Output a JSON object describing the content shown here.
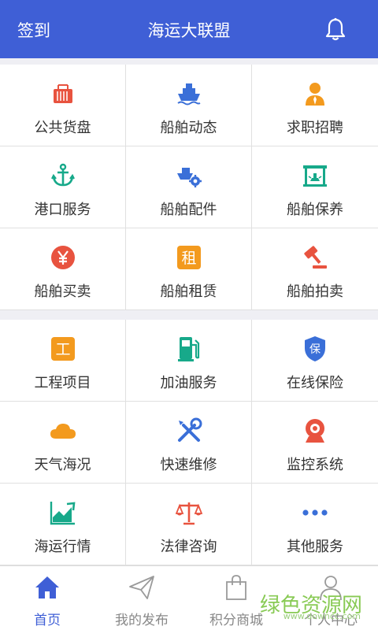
{
  "header": {
    "left_label": "签到",
    "title": "海运大联盟",
    "bell_icon": "bell-icon",
    "bg_color": "#3f5fd6"
  },
  "section1": [
    {
      "label": "公共货盘",
      "icon": "container-icon",
      "color": "#e8533f"
    },
    {
      "label": "船舶动态",
      "icon": "ship-icon",
      "color": "#3a6fd8"
    },
    {
      "label": "求职招聘",
      "icon": "recruit-icon",
      "color": "#f39a1e"
    },
    {
      "label": "港口服务",
      "icon": "anchor-icon",
      "color": "#17a98a"
    },
    {
      "label": "船舶配件",
      "icon": "ship-parts-icon",
      "color": "#3a6fd8"
    },
    {
      "label": "船舶保养",
      "icon": "maintenance-icon",
      "color": "#17a98a"
    },
    {
      "label": "船舶买卖",
      "icon": "yuan-icon",
      "color": "#e8533f"
    },
    {
      "label": "船舶租赁",
      "icon": "rent-icon",
      "color": "#f39a1e",
      "glyph": "租"
    },
    {
      "label": "船舶拍卖",
      "icon": "gavel-icon",
      "color": "#e8533f"
    }
  ],
  "section2": [
    {
      "label": "工程项目",
      "icon": "project-icon",
      "color": "#f39a1e",
      "glyph": "工"
    },
    {
      "label": "加油服务",
      "icon": "fuel-icon",
      "color": "#17a98a"
    },
    {
      "label": "在线保险",
      "icon": "insurance-shield-icon",
      "color": "#3a6fd8",
      "glyph": "保"
    },
    {
      "label": "天气海况",
      "icon": "cloud-icon",
      "color": "#f39a1e"
    },
    {
      "label": "快速维修",
      "icon": "tools-icon",
      "color": "#3a6fd8"
    },
    {
      "label": "监控系统",
      "icon": "camera-icon",
      "color": "#e8533f"
    },
    {
      "label": "海运行情",
      "icon": "trend-chart-icon",
      "color": "#17a98a"
    },
    {
      "label": "法律咨询",
      "icon": "scales-icon",
      "color": "#e8533f"
    },
    {
      "label": "其他服务",
      "icon": "more-dots-icon",
      "color": "#3a6fd8"
    }
  ],
  "tabs": [
    {
      "label": "首页",
      "icon": "home-icon",
      "active": true
    },
    {
      "label": "我的发布",
      "icon": "paper-plane-icon",
      "active": false
    },
    {
      "label": "积分商城",
      "icon": "shopping-bag-icon",
      "active": false
    },
    {
      "label": "个人中心",
      "icon": "user-icon",
      "active": false
    }
  ],
  "watermark": {
    "text": "绿色资源网",
    "sub": "www.downcc.com"
  }
}
